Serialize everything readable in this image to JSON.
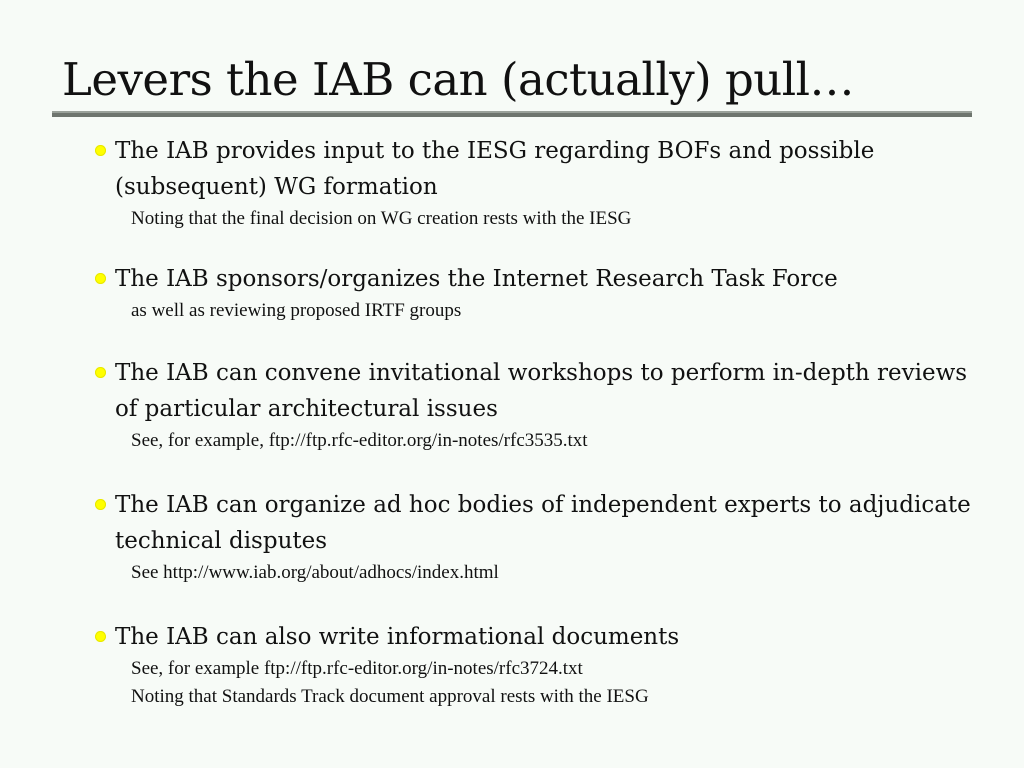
{
  "slide": {
    "title": "Levers the IAB can (actually) pull…",
    "bullets": [
      {
        "text": "The IAB provides input to the IESG regarding BOFs and possible (subsequent) WG formation",
        "subs": [
          "Noting that the final decision on WG creation rests with the IESG"
        ]
      },
      {
        "text": "The IAB sponsors/organizes the Internet Research Task Force",
        "subs": [
          "as well as reviewing proposed IRTF groups"
        ]
      },
      {
        "text": "The IAB can convene invitational workshops to perform in-depth reviews of particular architectural issues",
        "subs": [
          "See, for example, ftp://ftp.rfc-editor.org/in-notes/rfc3535.txt"
        ]
      },
      {
        "text": "The IAB can organize ad hoc bodies of independent experts to adjudicate technical disputes",
        "subs": [
          "See http://www.iab.org/about/adhocs/index.html"
        ]
      },
      {
        "text": "The IAB can also write informational documents",
        "subs": [
          "See, for example ftp://ftp.rfc-editor.org/in-notes/rfc3724.txt",
          "Noting that Standards Track document approval rests with the IESG"
        ]
      }
    ]
  },
  "colors": {
    "background": "#f7fbf7",
    "bullet": "#ffff00",
    "rule": "#6e756e"
  }
}
